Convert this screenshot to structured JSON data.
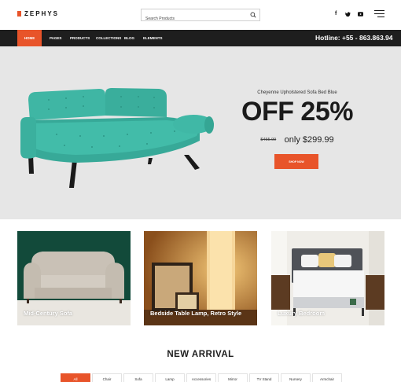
{
  "brand": {
    "name": "ZEPHYS",
    "accent_color": "#e8542a"
  },
  "header": {
    "search_placeholder": "Search Products",
    "social": [
      {
        "icon": "facebook-icon",
        "glyph": "f"
      },
      {
        "icon": "twitter-icon",
        "glyph": "t"
      },
      {
        "icon": "youtube-icon",
        "glyph": "▶"
      }
    ]
  },
  "nav": {
    "items": [
      "Home",
      "Pages",
      "Products",
      "Collections",
      "Blog",
      "Elements"
    ],
    "active": "Home",
    "hotline": "Hotline: +55 - 863.863.94"
  },
  "hero": {
    "subtitle": "Cheyenne Upholstered Sofa Bed Blue",
    "title": "OFF 25%",
    "old_price": "$455.99",
    "new_price": "only $299.99",
    "button": "Shop Now"
  },
  "categories": [
    {
      "label": "Mid-Century Sofa"
    },
    {
      "label": "Bedside Table Lamp, Retro Style"
    },
    {
      "label": "Luxury Bedroom"
    }
  ],
  "new_arrival": {
    "title": "NEW ARRIVAL",
    "filters": [
      "All",
      "Chair",
      "Sofa",
      "Lamp",
      "Accessories",
      "Mirror",
      "TV Stand",
      "Nursery",
      "Armchair"
    ],
    "active": "All"
  }
}
